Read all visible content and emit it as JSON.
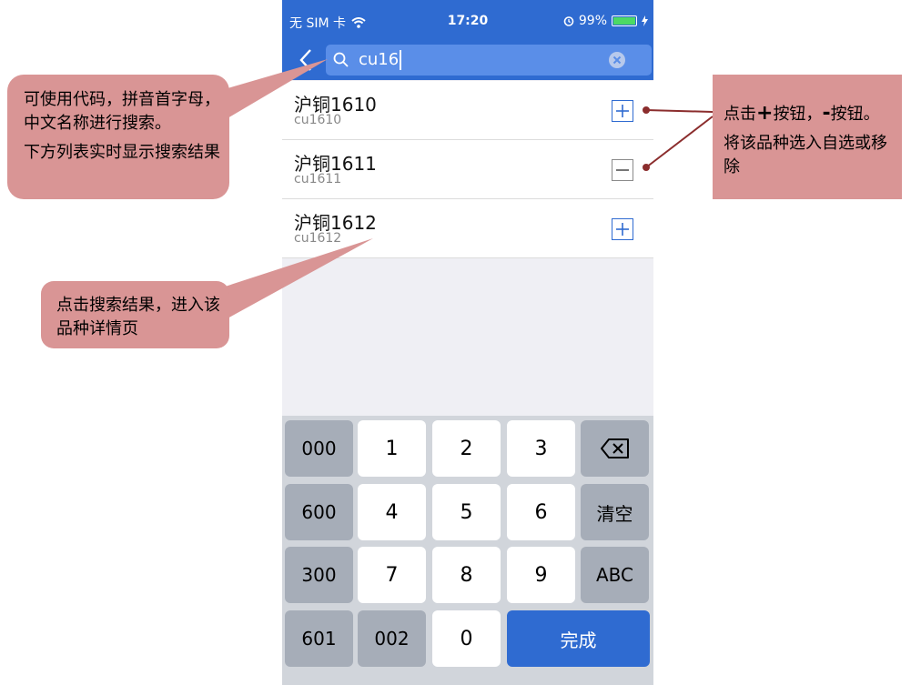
{
  "status_bar": {
    "carrier": "无 SIM 卡",
    "time": "17:20",
    "battery": "99%",
    "battery_level": 0.99,
    "wifi_icon": "wifi-icon",
    "alarm_icon": "alarm-icon",
    "charging_icon": "charging-bolt-icon"
  },
  "nav": {
    "back_icon": "chevron-left-icon",
    "search_value": "cu16",
    "search_icon": "search-icon",
    "clear_icon": "clear-circle-icon"
  },
  "results": [
    {
      "name": "沪铜1610",
      "code": "cu1610",
      "action": "add"
    },
    {
      "name": "沪铜1611",
      "code": "cu1611",
      "action": "remove"
    },
    {
      "name": "沪铜1612",
      "code": "cu1612",
      "action": "add"
    }
  ],
  "keyboard": {
    "keys": {
      "k000": "000",
      "k1": "1",
      "k2": "2",
      "k3": "3",
      "k600": "600",
      "k4": "4",
      "k5": "5",
      "k6": "6",
      "clear": "清空",
      "k300": "300",
      "k7": "7",
      "k8": "8",
      "k9": "9",
      "abc": "ABC",
      "k601": "601",
      "k002": "002",
      "k0": "0",
      "done": "完成"
    },
    "backspace_icon": "backspace-icon"
  },
  "callouts": {
    "search_hint_1": "可使用代码，拼音首字母，中文名称进行搜索。",
    "search_hint_2": "下方列表实时显示搜索结果",
    "detail_hint": "点击搜索结果，进入该品种详情页",
    "button_hint_1a": "点击",
    "button_hint_plus": "+",
    "button_hint_1b": "按钮，",
    "button_hint_minus": "-",
    "button_hint_1c": "按钮。",
    "button_hint_2": "将该品种选入自选或移除"
  },
  "colors": {
    "brand_blue": "#2f6bd1",
    "callout_fill": "#d99595",
    "connector_line": "#8b2d2d"
  }
}
